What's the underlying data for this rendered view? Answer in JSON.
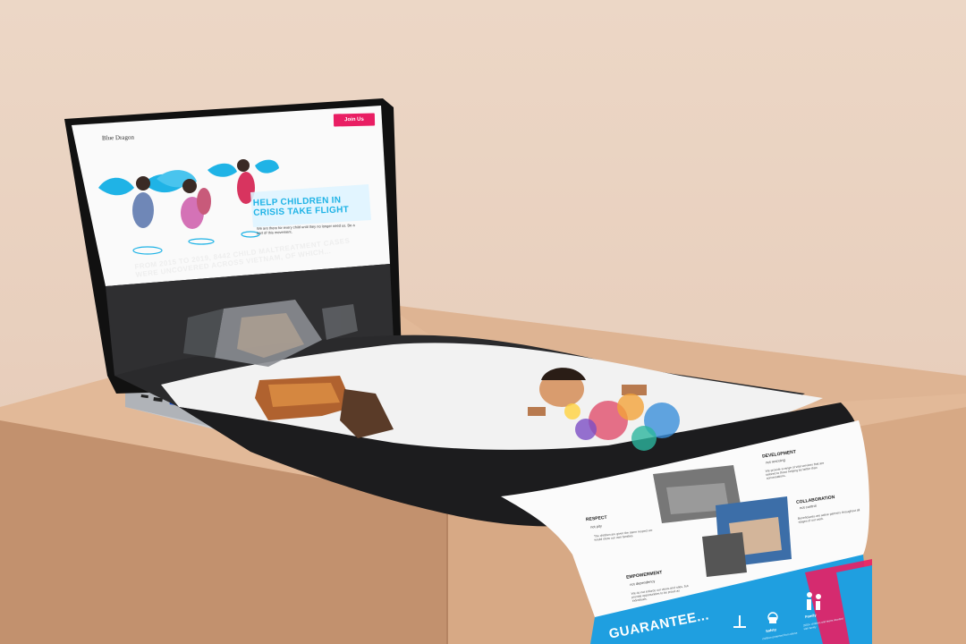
{
  "site": {
    "join_label": "Join Us",
    "logo_text": "Blue Dragon",
    "hero_headline": "HELP CHILDREN IN CRISIS TAKE FLIGHT",
    "hero_subtext": "We are there for every child until they no longer need us. Be a part of this movement.",
    "stats_headline": "FROM 2015 TO 2019, 8442 CHILD MALTREATMENT CASES WERE UNCOVERED ACROSS VIETNAM, OF WHICH...",
    "values": [
      {
        "title": "RESPECT",
        "sub": "not pity",
        "desc": "The children are given the same respect we would show our own families."
      },
      {
        "title": "EMPOWERMENT",
        "sub": "not dependency",
        "desc": "We do not enforce our views and rules, but provide opportunities to be proud as individuals."
      },
      {
        "title": "DEVELOPMENT",
        "sub": "not rescuing",
        "desc": "We provide a range of vital services that are tailored to those helping be better than conversations."
      },
      {
        "title": "COLLABORATION",
        "sub": "not control",
        "desc": "Beneficiaries are active partners throughout all stages of our work."
      }
    ],
    "guarantee_text": "GUARANTEE...",
    "guarantee_items": [
      {
        "label": "Safety",
        "desc": "children protected from abuse"
      },
      {
        "label": "Family",
        "desc": "2000+ children and teens reunited with family"
      }
    ]
  },
  "colors": {
    "accent_pink": "#e91e63",
    "accent_blue": "#1fb3e6",
    "dark_band": "#2f2f31",
    "pedestal": "#c99a78"
  },
  "icons": [
    "blue-dragon-logo-icon",
    "justice-scale-icon",
    "house-icon",
    "family-icon"
  ]
}
